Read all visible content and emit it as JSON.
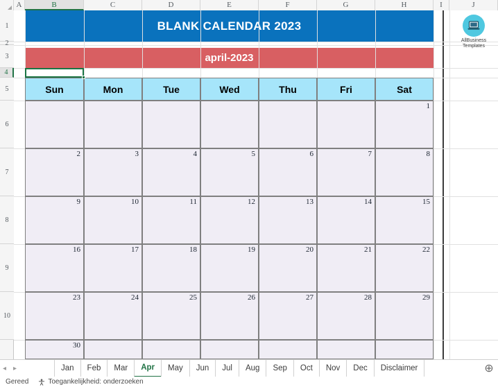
{
  "app": {
    "columns": [
      "A",
      "B",
      "C",
      "D",
      "E",
      "F",
      "G",
      "H",
      "I",
      "J"
    ],
    "active_column": "B",
    "rows": [
      "1",
      "2",
      "3",
      "4",
      "5",
      "6",
      "7",
      "8",
      "9",
      "10"
    ],
    "active_row": "4",
    "selected_cell": "B4"
  },
  "calendar": {
    "title": "BLANK CALENDAR 2023",
    "month_label": "april-2023",
    "day_headers": [
      "Sun",
      "Mon",
      "Tue",
      "Wed",
      "Thu",
      "Fri",
      "Sat"
    ],
    "weeks": [
      [
        "",
        "",
        "",
        "",
        "",
        "",
        "1"
      ],
      [
        "2",
        "3",
        "4",
        "5",
        "6",
        "7",
        "8"
      ],
      [
        "9",
        "10",
        "11",
        "12",
        "13",
        "14",
        "15"
      ],
      [
        "16",
        "17",
        "18",
        "19",
        "20",
        "21",
        "22"
      ],
      [
        "23",
        "24",
        "25",
        "26",
        "27",
        "28",
        "29"
      ],
      [
        "30",
        "",
        "",
        "",
        "",
        "",
        ""
      ]
    ]
  },
  "logo": {
    "line1": "AllBusiness",
    "line2": "Templates",
    "icon": "laptop-icon"
  },
  "tabs": {
    "prev_arrow": "◂",
    "next_arrow": "▸",
    "items": [
      {
        "label": "Jan",
        "active": false
      },
      {
        "label": "Feb",
        "active": false
      },
      {
        "label": "Mar",
        "active": false
      },
      {
        "label": "Apr",
        "active": true
      },
      {
        "label": "May",
        "active": false
      },
      {
        "label": "Jun",
        "active": false
      },
      {
        "label": "Jul",
        "active": false
      },
      {
        "label": "Aug",
        "active": false
      },
      {
        "label": "Sep",
        "active": false
      },
      {
        "label": "Oct",
        "active": false
      },
      {
        "label": "Nov",
        "active": false
      },
      {
        "label": "Dec",
        "active": false
      },
      {
        "label": "Disclaimer",
        "active": false
      }
    ],
    "add_sheet_label": "⊕"
  },
  "status": {
    "ready": "Gereed",
    "accessibility": "Toegankelijkheid: onderzoeken"
  },
  "colors": {
    "title_blue": "#0a72bd",
    "month_red": "#d85f62",
    "dow_cyan": "#a6e5fa",
    "cell_lavender": "#f0edf5",
    "excel_green": "#217346",
    "logo_cyan": "#4fc8e0"
  }
}
